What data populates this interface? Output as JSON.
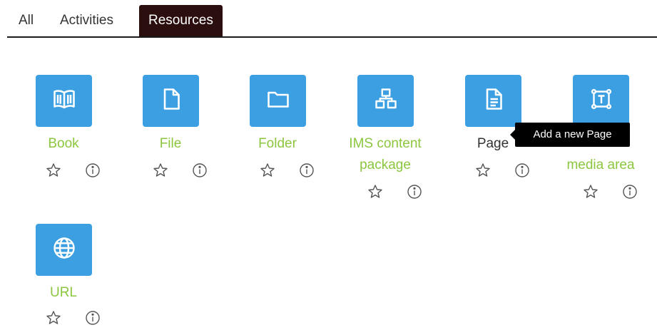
{
  "tabs": [
    {
      "label": "All"
    },
    {
      "label": "Activities"
    },
    {
      "label": "Resources",
      "active": true
    }
  ],
  "resources": [
    {
      "name": "Book",
      "icon": "book-icon"
    },
    {
      "name": "File",
      "icon": "file-icon"
    },
    {
      "name": "Folder",
      "icon": "folder-icon"
    },
    {
      "name_line1": "IMS content",
      "name_line2": "package",
      "icon": "package-icon"
    },
    {
      "name": "Page",
      "icon": "page-icon"
    },
    {
      "name_visible": "media area",
      "icon": "text-media-icon"
    },
    {
      "name": "URL",
      "icon": "globe-icon"
    }
  ],
  "tooltip": {
    "text": "Add a new Page"
  },
  "colors": {
    "tile": "#3c9fe2",
    "label": "#8cc63f",
    "active_tab": "#2b0e0e",
    "tooltip_bg": "#000000"
  }
}
